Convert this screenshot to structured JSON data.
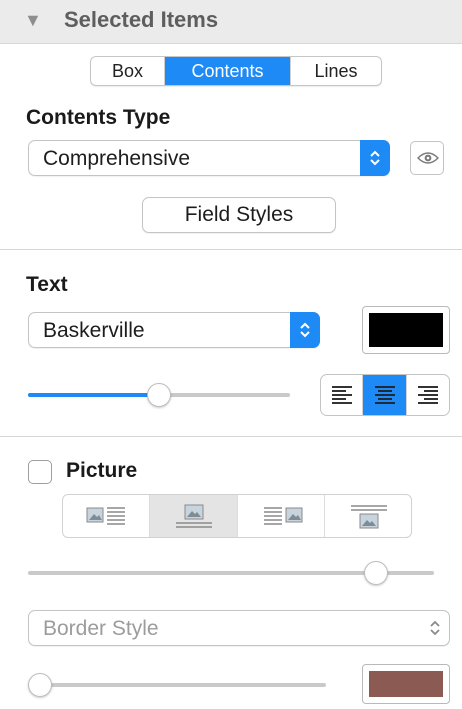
{
  "inspector": {
    "section_title": "Selected Items"
  },
  "tabs": [
    {
      "label": "Box",
      "selected": false
    },
    {
      "label": "Contents",
      "selected": true
    },
    {
      "label": "Lines",
      "selected": false
    }
  ],
  "contents": {
    "heading": "Contents Type",
    "type_value": "Comprehensive",
    "field_styles_label": "Field Styles"
  },
  "text": {
    "heading": "Text",
    "font_value": "Baskerville",
    "color": "#000000",
    "size_slider_fraction": 0.5,
    "alignment_options": [
      "align-left",
      "align-center",
      "align-right"
    ],
    "alignment_selected": "align-center"
  },
  "picture": {
    "label": "Picture",
    "checked": false,
    "position_options": [
      "picture-left",
      "picture-above",
      "picture-right",
      "picture-below"
    ],
    "position_selected": "picture-above",
    "spacing_slider_fraction": 0.88,
    "border_style_placeholder": "Border Style",
    "border_slider_fraction": 0.0,
    "border_color": "#8b5a52"
  },
  "colors": {
    "accent": "#1d8af5",
    "header_bg": "#ebebeb",
    "disabled_text": "#9c9c9c"
  }
}
